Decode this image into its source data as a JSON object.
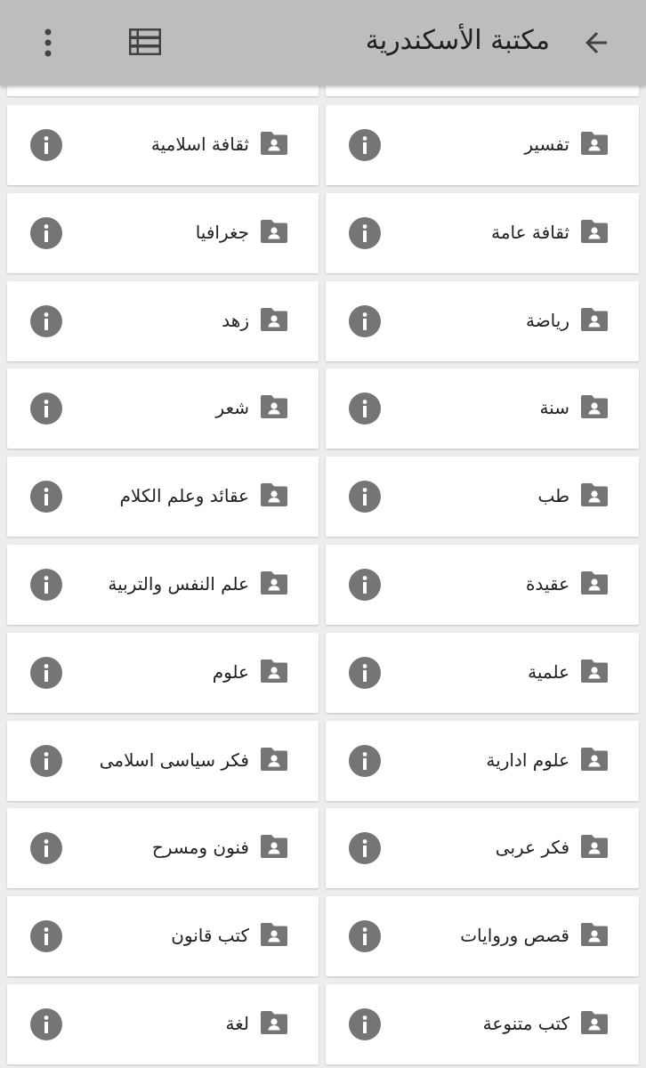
{
  "app_bar": {
    "title": "مكتبة الأسكندرية",
    "icons": {
      "back": "arrow-back-icon",
      "view": "view-list-icon",
      "more": "more-vertical-icon"
    },
    "background": "#bdbdbd"
  },
  "folder_icon": "shared-folder-icon",
  "info_icon": "info-icon",
  "icon_color": "#757575",
  "categories": [
    {
      "right": "تفسير",
      "left": "ثقافة اسلامية"
    },
    {
      "right": "ثقافة عامة",
      "left": "جغرافيا"
    },
    {
      "right": "رياضة",
      "left": "زهد"
    },
    {
      "right": "سنة",
      "left": "شعر"
    },
    {
      "right": "طب",
      "left": "عقائد وعلم الكلام"
    },
    {
      "right": "عقيدة",
      "left": "علم النفس والتربية"
    },
    {
      "right": "علمية",
      "left": "علوم"
    },
    {
      "right": "علوم ادارية",
      "left": "فكر سياسى اسلامى"
    },
    {
      "right": "فكر عربى",
      "left": "فنون ومسرح"
    },
    {
      "right": "قصص وروايات",
      "left": "كتب قانون"
    },
    {
      "right": "كتب متنوعة",
      "left": "لغة"
    }
  ]
}
